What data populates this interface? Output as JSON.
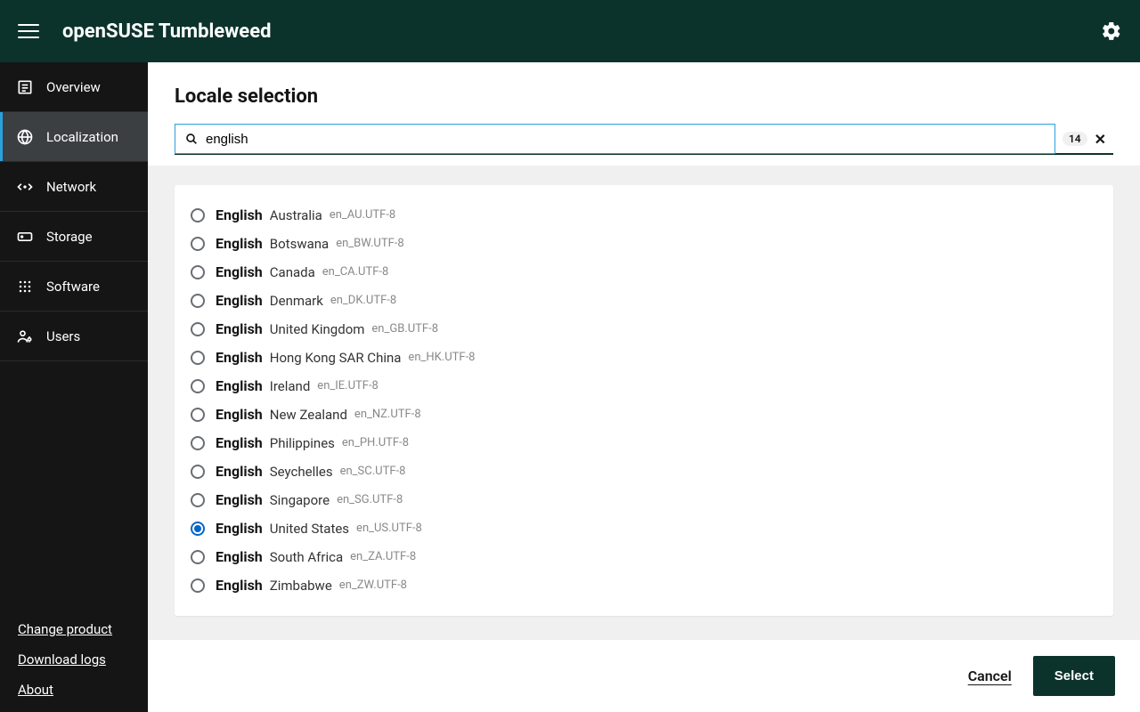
{
  "header": {
    "title": "openSUSE Tumbleweed"
  },
  "sidebar": {
    "items": [
      {
        "label": "Overview"
      },
      {
        "label": "Localization"
      },
      {
        "label": "Network"
      },
      {
        "label": "Storage"
      },
      {
        "label": "Software"
      },
      {
        "label": "Users"
      }
    ],
    "footer": {
      "change_product": "Change product",
      "download_logs": "Download logs",
      "about": "About"
    }
  },
  "page": {
    "title": "Locale selection",
    "search_value": "english",
    "result_count": "14"
  },
  "locales": [
    {
      "lang": "English",
      "region": "Australia",
      "code": "en_AU.UTF-8",
      "selected": false
    },
    {
      "lang": "English",
      "region": "Botswana",
      "code": "en_BW.UTF-8",
      "selected": false
    },
    {
      "lang": "English",
      "region": "Canada",
      "code": "en_CA.UTF-8",
      "selected": false
    },
    {
      "lang": "English",
      "region": "Denmark",
      "code": "en_DK.UTF-8",
      "selected": false
    },
    {
      "lang": "English",
      "region": "United Kingdom",
      "code": "en_GB.UTF-8",
      "selected": false
    },
    {
      "lang": "English",
      "region": "Hong Kong SAR China",
      "code": "en_HK.UTF-8",
      "selected": false
    },
    {
      "lang": "English",
      "region": "Ireland",
      "code": "en_IE.UTF-8",
      "selected": false
    },
    {
      "lang": "English",
      "region": "New Zealand",
      "code": "en_NZ.UTF-8",
      "selected": false
    },
    {
      "lang": "English",
      "region": "Philippines",
      "code": "en_PH.UTF-8",
      "selected": false
    },
    {
      "lang": "English",
      "region": "Seychelles",
      "code": "en_SC.UTF-8",
      "selected": false
    },
    {
      "lang": "English",
      "region": "Singapore",
      "code": "en_SG.UTF-8",
      "selected": false
    },
    {
      "lang": "English",
      "region": "United States",
      "code": "en_US.UTF-8",
      "selected": true
    },
    {
      "lang": "English",
      "region": "South Africa",
      "code": "en_ZA.UTF-8",
      "selected": false
    },
    {
      "lang": "English",
      "region": "Zimbabwe",
      "code": "en_ZW.UTF-8",
      "selected": false
    }
  ],
  "actions": {
    "cancel": "Cancel",
    "select": "Select"
  }
}
